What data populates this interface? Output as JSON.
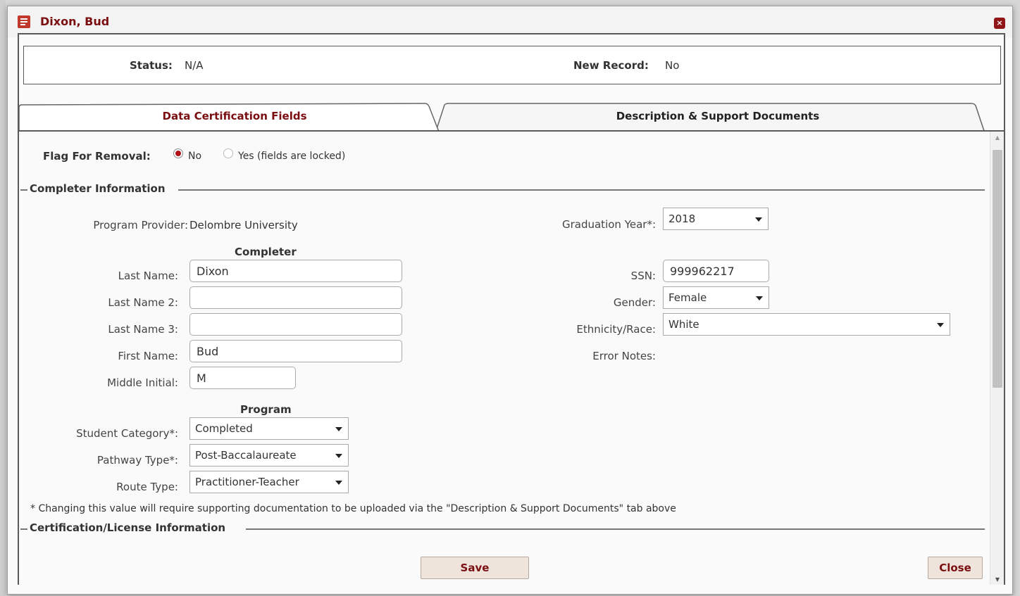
{
  "window": {
    "title": "Dixon, Bud",
    "close_glyph": "×"
  },
  "status_bar": {
    "status_label": "Status:",
    "status_value": "N/A",
    "new_record_label": "New Record:",
    "new_record_value": "No"
  },
  "tabs": [
    {
      "label": "Data Certification Fields",
      "active": true
    },
    {
      "label": "Description & Support Documents",
      "active": false
    }
  ],
  "flag_for_removal": {
    "label": "Flag For Removal:",
    "options": [
      {
        "label": "No",
        "checked": true
      },
      {
        "label": "Yes (fields are locked)",
        "checked": false
      }
    ]
  },
  "completer_information": {
    "legend": "Completer Information",
    "program_provider_label": "Program Provider:",
    "program_provider_value": "Delombre University",
    "graduation_year_label": "Graduation Year*:",
    "graduation_year_value": "2018",
    "completer_heading": "Completer",
    "last_name_label": "Last Name:",
    "last_name_value": "Dixon",
    "last_name2_label": "Last Name 2:",
    "last_name2_value": "",
    "last_name3_label": "Last Name 3:",
    "last_name3_value": "",
    "first_name_label": "First Name:",
    "first_name_value": "Bud",
    "middle_initial_label": "Middle Initial:",
    "middle_initial_value": "M",
    "ssn_label": "SSN:",
    "ssn_value": "999962217",
    "gender_label": "Gender:",
    "gender_value": "Female",
    "ethnicity_label": "Ethnicity/Race:",
    "ethnicity_value": "White",
    "error_notes_label": "Error Notes:",
    "program_heading": "Program",
    "student_category_label": "Student Category*:",
    "student_category_value": "Completed",
    "pathway_type_label": "Pathway Type*:",
    "pathway_type_value": "Post-Baccalaureate",
    "route_type_label": "Route Type:",
    "route_type_value": "Practitioner-Teacher",
    "footnote": "* Changing this value will require supporting documentation to be uploaded via the \"Description & Support Documents\" tab above"
  },
  "certification_information": {
    "legend": "Certification/License Information"
  },
  "buttons": {
    "save": "Save",
    "close": "Close"
  },
  "colors": {
    "accent": "#7a0e10",
    "radio_checked": "#b01015",
    "button_bg": "#efe4dc"
  }
}
